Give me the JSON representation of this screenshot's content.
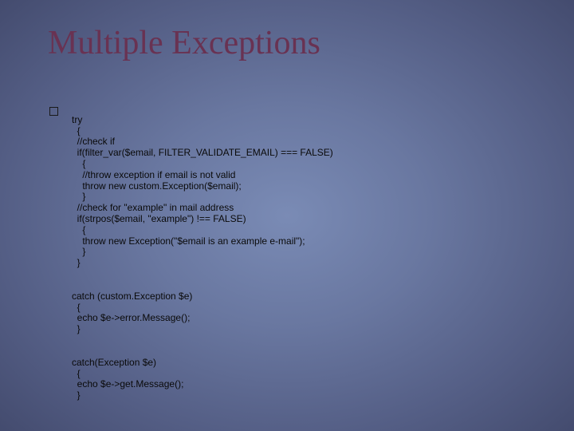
{
  "title": "Multiple Exceptions",
  "code": {
    "try_kw": "try",
    "try_body": "  {\n  //check if\n  if(filter_var($email, FILTER_VALIDATE_EMAIL) === FALSE)\n    {\n    //throw exception if email is not valid\n    throw new custom.Exception($email);\n    }\n  //check for \"example\" in mail address\n  if(strpos($email, \"example\") !== FALSE)\n    {\n    throw new Exception(\"$email is an example e-mail\");\n    }\n  }",
    "catch1": "catch (custom.Exception $e)\n  {\n  echo $e->error.Message();\n  }",
    "catch2": "catch(Exception $e)\n  {\n  echo $e->get.Message();\n  }"
  }
}
